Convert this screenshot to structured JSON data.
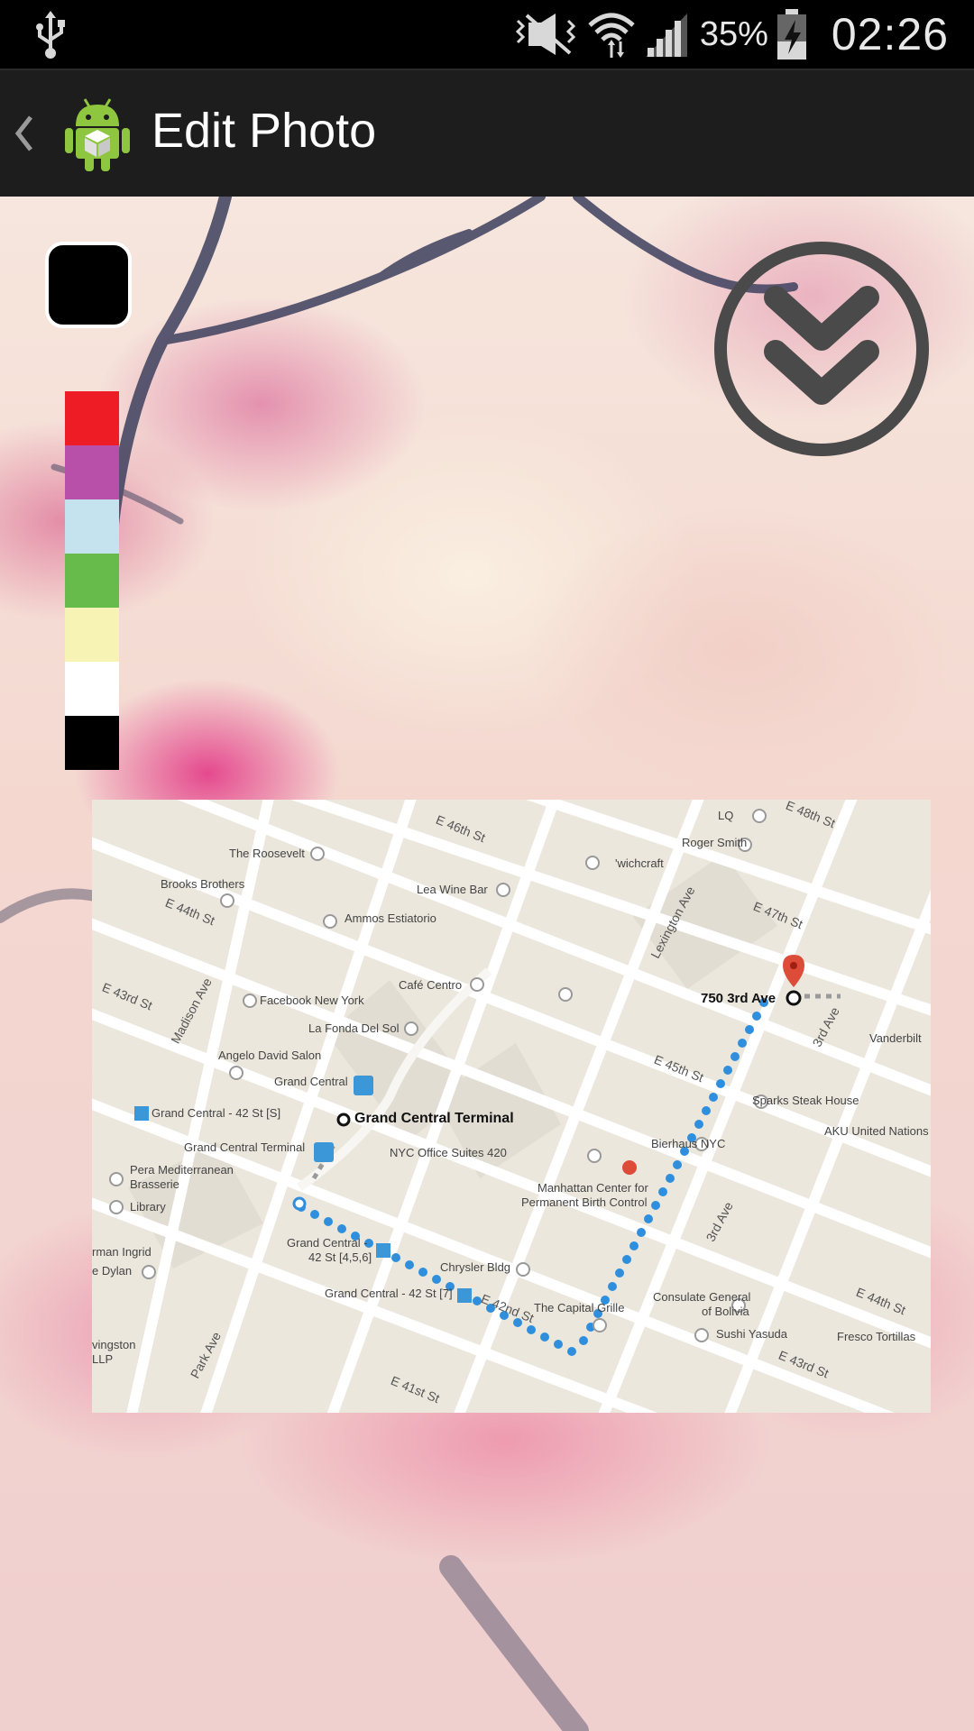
{
  "status_bar": {
    "battery_percent": "35%",
    "time": "02:26",
    "icons": [
      "usb-icon",
      "mute-vibrate-icon",
      "wifi-icon",
      "signal-icon",
      "battery-charging-icon"
    ]
  },
  "action_bar": {
    "title": "Edit Photo",
    "back_icon": "chevron-left-icon",
    "app_icon": "android-app-icon"
  },
  "editor": {
    "current_color": "#000000",
    "palette": [
      "#ee1c24",
      "#b84fa8",
      "#c5e3ee",
      "#67bb4a",
      "#f6f3b5",
      "#ffffff",
      "#000000"
    ],
    "collapse_icon": "double-chevron-down-icon"
  },
  "map": {
    "labels": {
      "the_roosevelt": "The Roosevelt",
      "brooks_brothers": "Brooks Brothers",
      "e46": "E 46th St",
      "lq": "LQ",
      "e48": "E 48th St",
      "roger_smith": "Roger Smith",
      "wichcraft": "'wichcraft",
      "lea_wine_bar": "Lea Wine Bar",
      "e44_left": "E 44th St",
      "ammos": "Ammos Estiatorio",
      "lexington": "Lexington Ave",
      "e47": "E 47th St",
      "e43_left": "E 43rd St",
      "madison": "Madison Ave",
      "cafe_centro": "Café Centro",
      "facebook_ny": "Facebook New York",
      "address": "750 3rd Ave",
      "third_ave_top": "3rd Ave",
      "la_fonda": "La Fonda Del Sol",
      "vanderbilt": "Vanderbilt",
      "angelo": "Angelo David Salon",
      "grand_central_1": "Grand Central",
      "e45": "E 45th St",
      "sparks": "Sparks Steak House",
      "gc_42_s": "Grand Central - 42 St [S]",
      "gc_terminal_bold": "Grand Central Terminal",
      "aku": "AKU United Nations",
      "gc_terminal": "Grand Central Terminal",
      "bierhaus": "Bierhaus NYC",
      "nyc_office": "NYC Office Suites 420",
      "pera_1": "Pera Mediterranean",
      "pera_2": "Brasserie",
      "manhattan_center_1": "Manhattan Center for",
      "manhattan_center_2": "Permanent Birth Control",
      "library": "Library",
      "third_ave_mid": "3rd Ave",
      "rman_ingrid": "rman Ingrid",
      "gc_42_456_1": "Grand Central -",
      "gc_42_456_2": "42 St [4,5,6]",
      "chrysler": "Chrysler Bldg",
      "e_dylan": "e Dylan",
      "consulate_1": "Consulate General",
      "consulate_2": "of Bolivia",
      "e44_right": "E 44th St",
      "gc_42_7": "Grand Central - 42 St [7]",
      "e42": "E 42nd St",
      "capital_grille": "The Capital Grille",
      "fresco": "Fresco Tortillas",
      "sushi": "Sushi Yasuda",
      "ingston": "vingston",
      "llp": "LLP",
      "e43_right": "E 43rd St",
      "park_ave": "Park Ave",
      "e41": "E 41st St"
    }
  }
}
